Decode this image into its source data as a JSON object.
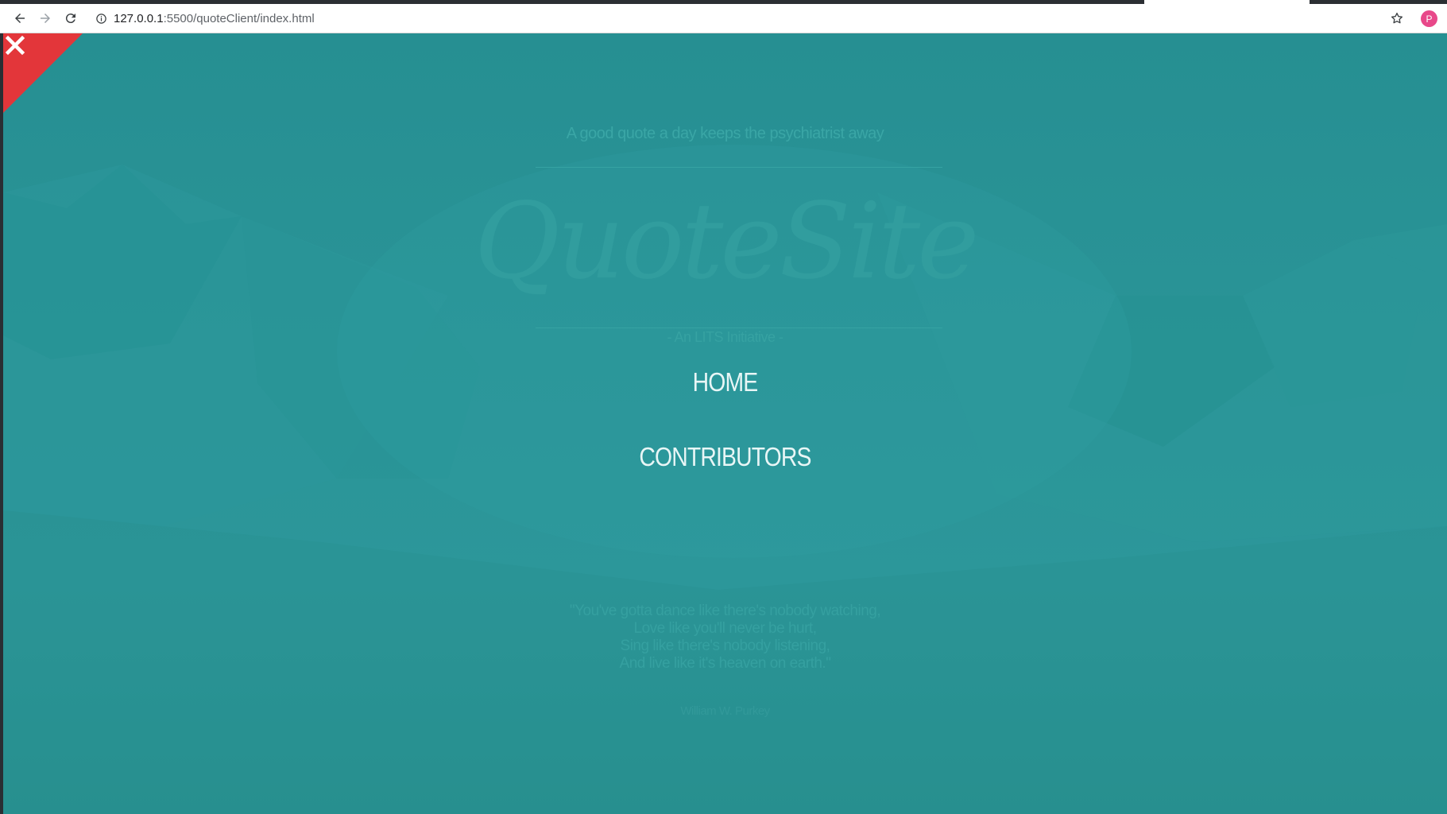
{
  "browser": {
    "url_host": "127.0.0.1",
    "url_path": ":5500/quoteClient/index.html",
    "profile_initial": "P",
    "icons": [
      "back-icon",
      "forward-icon",
      "reload-icon",
      "info-icon",
      "star-icon"
    ]
  },
  "page": {
    "tagline": "A good quote a day keeps the psychiatrist away",
    "logo": "QuoteSite",
    "initiative": "- An LITS Initiative -",
    "nav": {
      "home": "HOME",
      "contributors": "CONTRIBUTORS"
    },
    "quote_lines": [
      "\"You've gotta dance like there's nobody watching,",
      "Love like you'll never be hurt,",
      "Sing like there's nobody listening,",
      "And live like it's heaven on earth.\""
    ],
    "quote_author": "William W. Purkey",
    "colors": {
      "accent_close": "#e3363a",
      "background": "#2a9497",
      "nav_text": "#e8f6f6"
    }
  }
}
